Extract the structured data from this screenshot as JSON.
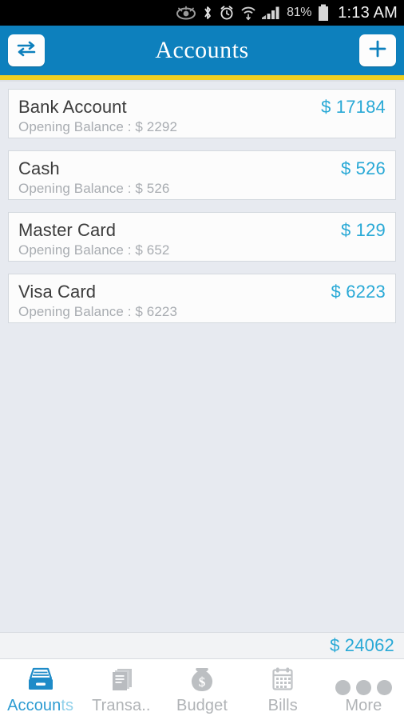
{
  "status_bar": {
    "icons": [
      "smart-stay-eye-icon",
      "bluetooth-icon",
      "alarm-clock-icon",
      "wifi-icon",
      "signal-bars-icon"
    ],
    "battery_percent": "81%",
    "time": "1:13 AM"
  },
  "header": {
    "title": "Accounts",
    "left_button": "transfer-icon",
    "right_button": "plus-icon",
    "bg_color": "#0d80bd",
    "accent_color": "#f0cf21"
  },
  "accounts": [
    {
      "name": "Bank Account",
      "amount": "$ 17184",
      "opening": "Opening Balance : $ 2292"
    },
    {
      "name": "Cash",
      "amount": "$ 526",
      "opening": "Opening Balance : $ 526"
    },
    {
      "name": "Master Card",
      "amount": "$ 129",
      "opening": "Opening Balance : $ 652"
    },
    {
      "name": "Visa Card",
      "amount": "$ 6223",
      "opening": "Opening Balance : $ 6223"
    }
  ],
  "total": {
    "amount": "$ 24062",
    "color": "#29a9d6"
  },
  "tabs": [
    {
      "label": "Accoun",
      "label_clipped": "ts",
      "icon": "file-drawer-icon",
      "active": true
    },
    {
      "label": "Transa..",
      "label_clipped": "",
      "icon": "documents-icon",
      "active": false
    },
    {
      "label": "Budget",
      "label_clipped": "",
      "icon": "money-bag-icon",
      "active": false
    },
    {
      "label": "Bills",
      "label_clipped": "",
      "icon": "calendar-icon",
      "active": false
    },
    {
      "label": "More",
      "label_clipped": "",
      "icon": "three-dots-icon",
      "active": false
    }
  ]
}
